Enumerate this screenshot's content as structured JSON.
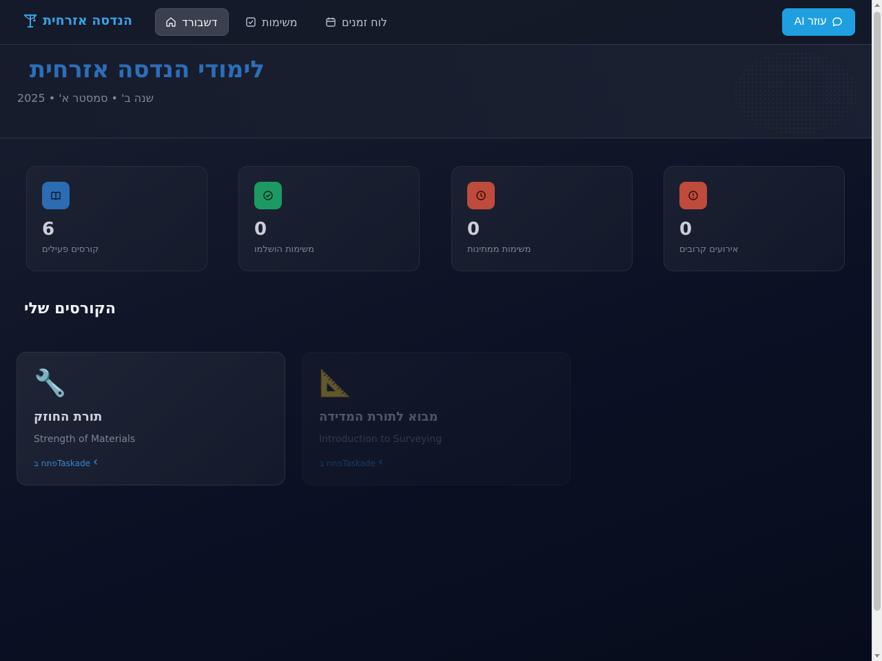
{
  "navbar": {
    "brand": "הנדסה אזרחית",
    "brand_icon": "construction-icon",
    "items": [
      {
        "label": "דשבורד",
        "icon": "home-icon",
        "active": true
      },
      {
        "label": "משימות",
        "icon": "checkbox-icon",
        "active": false
      },
      {
        "label": "לוח זמנים",
        "icon": "calendar-icon",
        "active": false
      }
    ],
    "ai_button": "עוזר AI",
    "ai_icon": "chat-bubble-icon"
  },
  "header": {
    "title": "לימודי הנדסה אזרחית",
    "subtitle": "שנה ב' • סמסטר א' • 2025"
  },
  "stats": [
    {
      "value": "6",
      "label": "קורסים פעילים",
      "icon": "book-icon",
      "color": "#2b6cb2"
    },
    {
      "value": "0",
      "label": "משימות הושלמו",
      "icon": "check-circle-icon",
      "color": "#1d9a63"
    },
    {
      "value": "0",
      "label": "משימות ממתינות",
      "icon": "clock-icon",
      "color": "#bf4b3c"
    },
    {
      "value": "0",
      "label": "אירועים קרובים",
      "icon": "alert-circle-icon",
      "color": "#bf4b3c"
    }
  ],
  "courses_section": {
    "title": "הקורסים שלי"
  },
  "courses": [
    {
      "emoji": "🔧",
      "name": "תורת החוזק",
      "english": "Strength of Materials",
      "link": "פתח בTaskade"
    },
    {
      "emoji": "📐",
      "name": "מבוא לתורת המדידה",
      "english": "Introduction to Surveying",
      "link": "פתח בTaskade"
    }
  ]
}
